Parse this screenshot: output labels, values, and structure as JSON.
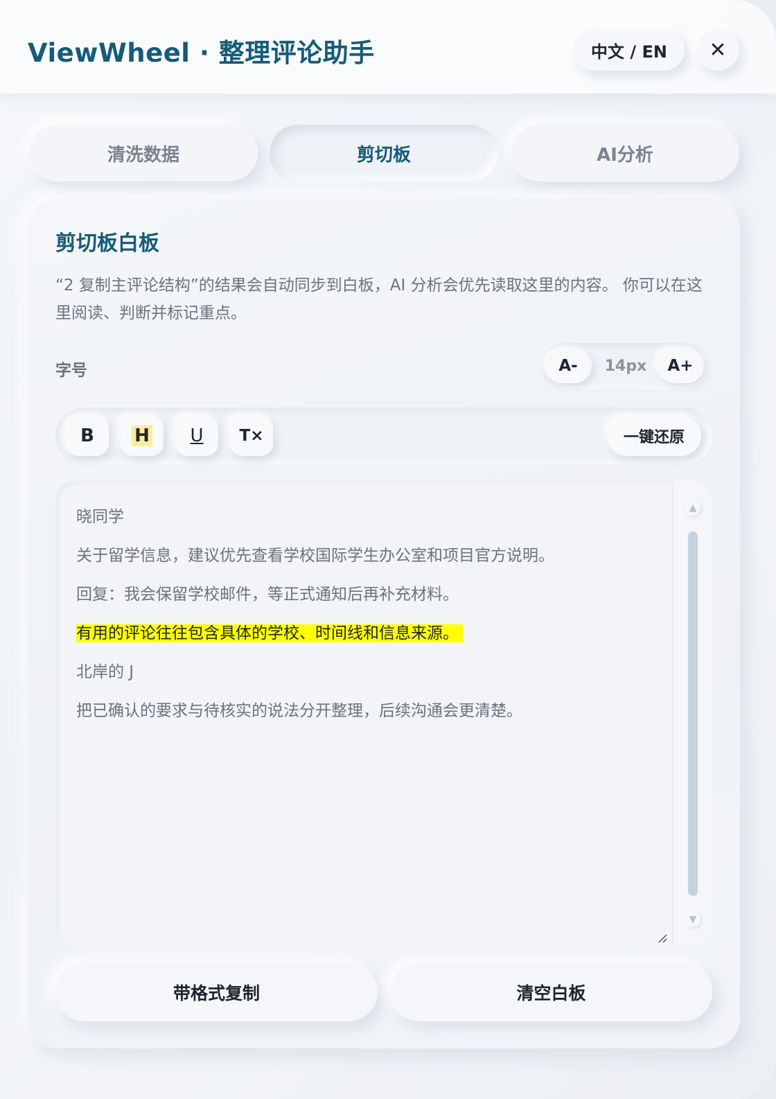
{
  "header": {
    "title": "ViewWheel · 整理评论助手",
    "lang_toggle": "中文 / EN",
    "close_glyph": "✕"
  },
  "tabs": [
    {
      "label": "清洗数据",
      "active": false
    },
    {
      "label": "剪切板",
      "active": true
    },
    {
      "label": "AI分析",
      "active": false
    }
  ],
  "clipboard": {
    "title": "剪切板白板",
    "description": "“2 复制主评论结构”的结果会自动同步到白板，AI 分析会优先读取这里的内容。 你可以在这里阅读、判断并标记重点。",
    "font_size": {
      "label": "字号",
      "decrease": "A-",
      "value": "14px",
      "increase": "A+"
    },
    "toolbar": {
      "bold": "B",
      "highlight": "H",
      "underline": "U",
      "clear_format": "T×",
      "restore": "一键还原"
    },
    "content": [
      {
        "text": "晓同学",
        "highlighted": false
      },
      {
        "text": "关于留学信息，建议优先查看学校国际学生办公室和项目官方说明。",
        "highlighted": false
      },
      {
        "text": "回复：我会保留学校邮件，等正式通知后再补充材料。",
        "highlighted": false
      },
      {
        "text": "有用的评论往往包含具体的学校、时间线和信息来源。",
        "highlighted": true
      },
      {
        "text": "北岸的 J",
        "highlighted": false
      },
      {
        "text": "把已确认的要求与待核实的说法分开整理，后续沟通会更清楚。",
        "highlighted": false
      }
    ],
    "actions": {
      "copy_formatted": "带格式复制",
      "clear_board": "清空白板"
    }
  },
  "colors": {
    "accent": "#165b78",
    "highlight": "#ffff00",
    "highlight_button": "#fbeb9a"
  }
}
